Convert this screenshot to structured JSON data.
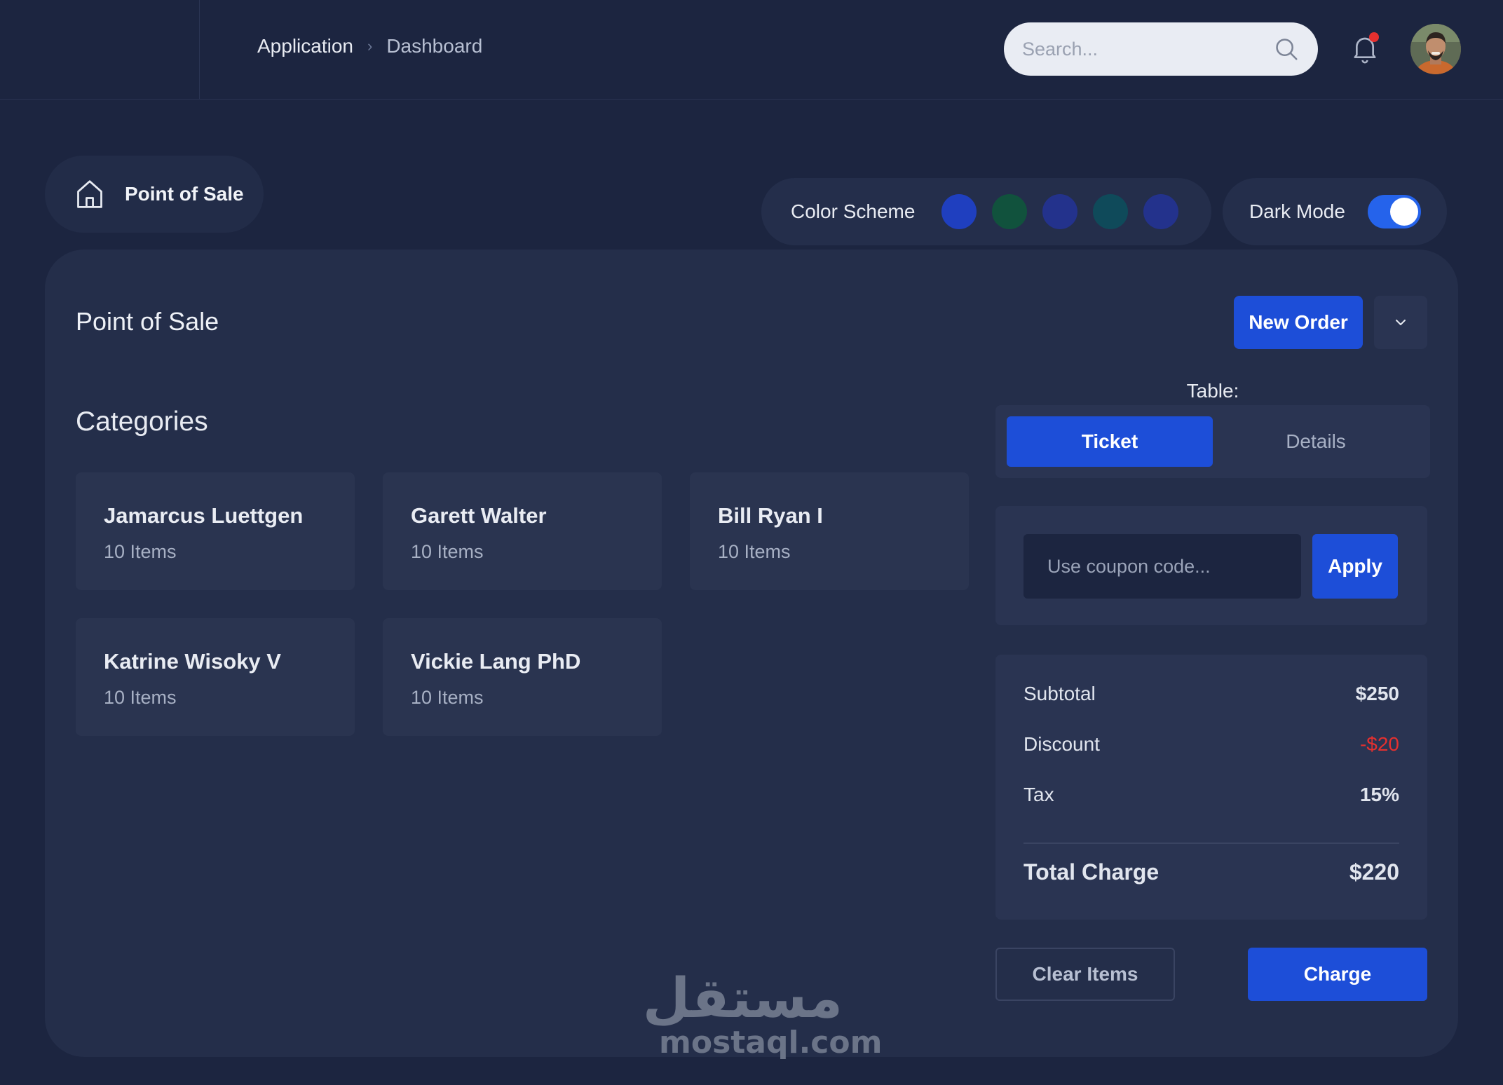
{
  "header": {
    "breadcrumb": {
      "root": "Application",
      "current": "Dashboard"
    },
    "search": {
      "placeholder": "Search..."
    },
    "notification_icon": "bell-icon",
    "avatar_icon": "user-avatar"
  },
  "page": {
    "pill_label": "Point of Sale",
    "pill_icon": "home-icon",
    "color_scheme": {
      "label": "Color Scheme",
      "swatches": [
        "#1f3fbf",
        "#11523d",
        "#23328c",
        "#0f4a5a",
        "#23328c"
      ]
    },
    "dark_mode": {
      "label": "Dark Mode",
      "enabled": true
    }
  },
  "main": {
    "title": "Point of Sale",
    "new_order_label": "New Order",
    "menu_icon": "chevron-down-icon",
    "categories_title": "Categories",
    "categories": [
      {
        "name": "Jamarcus Luettgen",
        "count": "10 Items"
      },
      {
        "name": "Garett Walter",
        "count": "10 Items"
      },
      {
        "name": "Bill Ryan I",
        "count": "10 Items"
      },
      {
        "name": "Katrine Wisoky V",
        "count": "10 Items"
      },
      {
        "name": "Vickie Lang PhD",
        "count": "10 Items"
      }
    ]
  },
  "panel": {
    "table_label": "Table:",
    "tabs": [
      {
        "label": "Ticket",
        "active": true
      },
      {
        "label": "Details",
        "active": false
      }
    ],
    "coupon": {
      "placeholder": "Use coupon code...",
      "apply_label": "Apply"
    },
    "summary": {
      "subtotal_label": "Subtotal",
      "subtotal": "$250",
      "discount_label": "Discount",
      "discount": "-$20",
      "tax_label": "Tax",
      "tax": "15%",
      "total_label": "Total Charge",
      "total": "$220"
    },
    "clear_label": "Clear Items",
    "charge_label": "Charge"
  },
  "watermark": {
    "arabic": "مستقل",
    "latin": "mostaql.com"
  },
  "colors": {
    "accent": "#1d4ed8",
    "negative": "#e5302f",
    "background": "#1c2540",
    "card": "#242e4a"
  }
}
